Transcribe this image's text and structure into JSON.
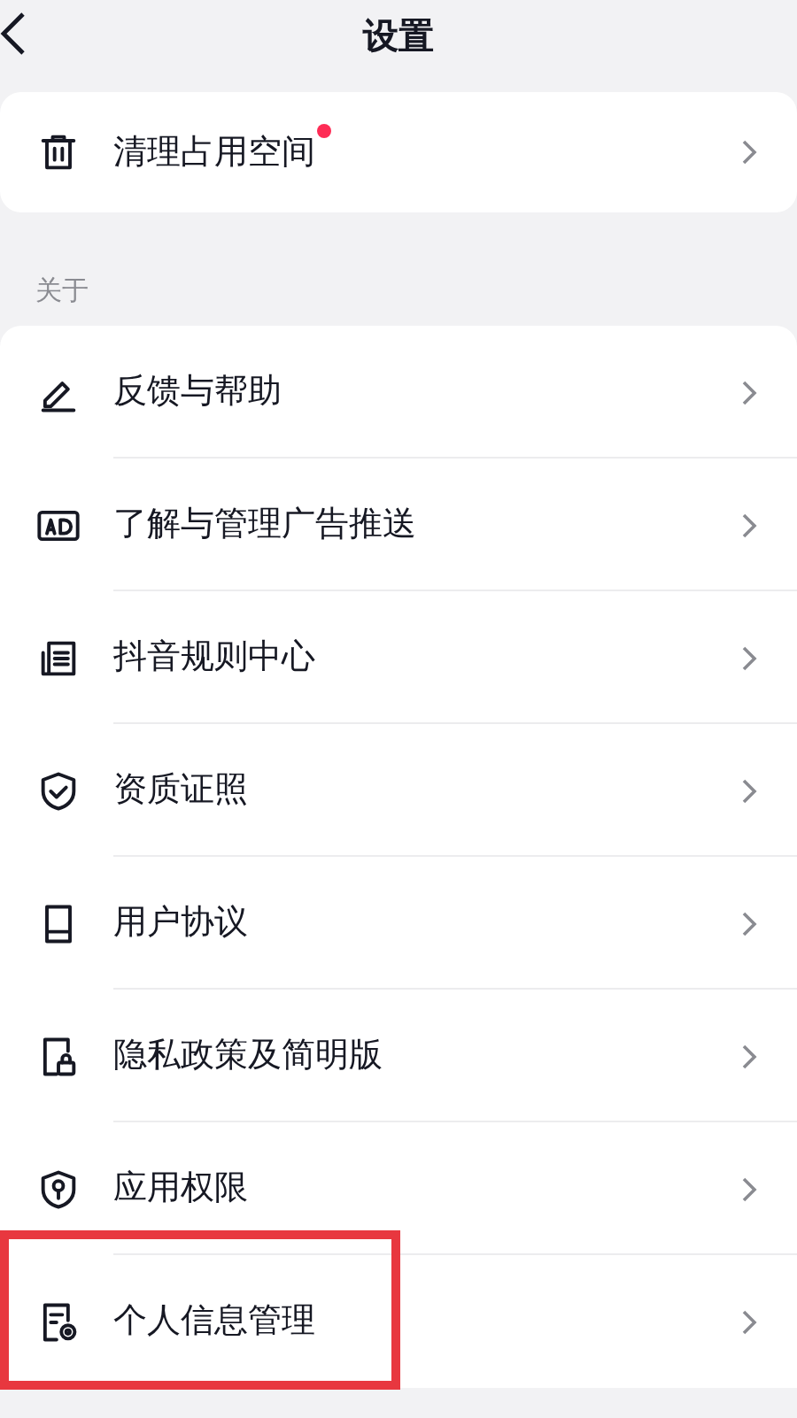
{
  "header": {
    "title": "设置"
  },
  "storage_card": [
    {
      "kind": "trash",
      "label": "清理占用空间",
      "badge": true,
      "highlighted": false
    }
  ],
  "about_section": {
    "title": "关于",
    "items": [
      {
        "kind": "pen",
        "label": "反馈与帮助",
        "badge": false,
        "highlighted": false
      },
      {
        "kind": "ad",
        "label": "了解与管理广告推送",
        "badge": false,
        "highlighted": false
      },
      {
        "kind": "rules",
        "label": "抖音规则中心",
        "badge": false,
        "highlighted": false
      },
      {
        "kind": "shield-check",
        "label": "资质证照",
        "badge": false,
        "highlighted": false
      },
      {
        "kind": "book",
        "label": "用户协议",
        "badge": false,
        "highlighted": false
      },
      {
        "kind": "doc-lock",
        "label": "隐私政策及简明版",
        "badge": false,
        "highlighted": false
      },
      {
        "kind": "shield-key",
        "label": "应用权限",
        "badge": false,
        "highlighted": false
      },
      {
        "kind": "doc-gear",
        "label": "个人信息管理",
        "badge": false,
        "highlighted": true
      }
    ]
  }
}
